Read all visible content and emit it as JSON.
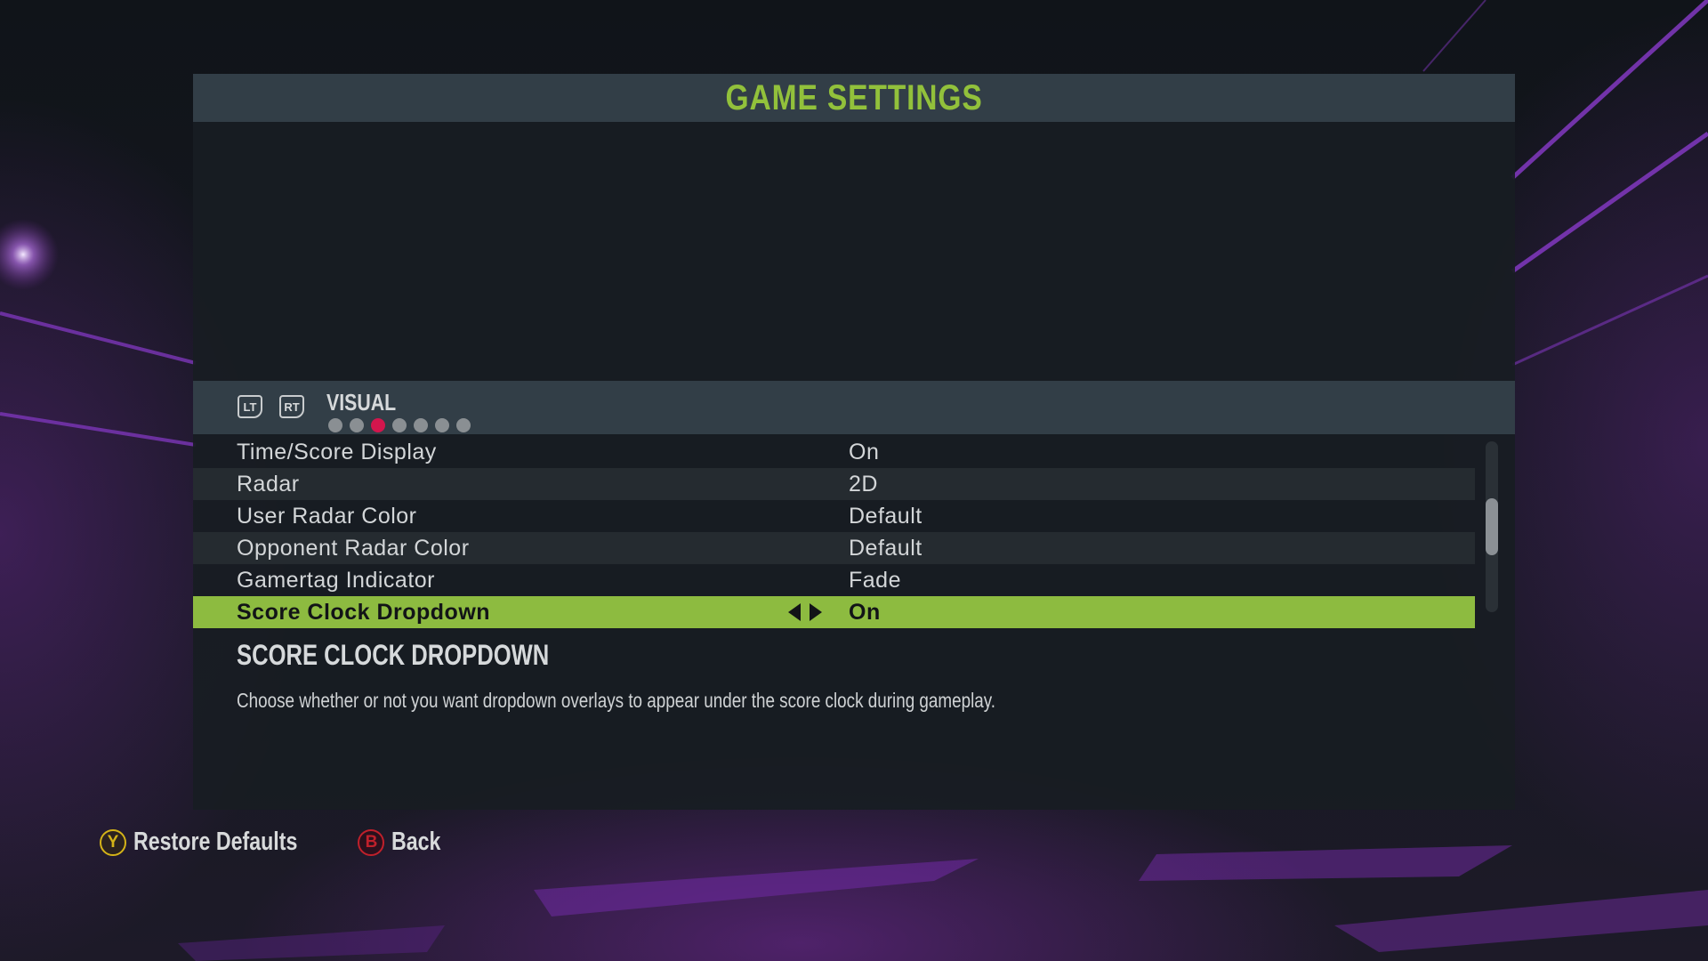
{
  "header": {
    "title": "GAME SETTINGS"
  },
  "tabs": {
    "left_trigger": "LT",
    "right_trigger": "RT",
    "current_label": "VISUAL",
    "page_count": 7,
    "current_page": 3
  },
  "settings": [
    {
      "label": "Time/Score Display",
      "value": "On"
    },
    {
      "label": "Radar",
      "value": "2D"
    },
    {
      "label": "User Radar Color",
      "value": "Default"
    },
    {
      "label": "Opponent Radar Color",
      "value": "Default"
    },
    {
      "label": "Gamertag Indicator",
      "value": "Fade"
    },
    {
      "label": "Score Clock Dropdown",
      "value": "On",
      "selected": true
    }
  ],
  "description": {
    "title": "SCORE CLOCK DROPDOWN",
    "text": "Choose whether or not you want dropdown overlays to appear under the score clock during gameplay."
  },
  "footer": {
    "restore": {
      "button": "Y",
      "label": "Restore Defaults"
    },
    "back": {
      "button": "B",
      "label": "Back"
    }
  },
  "colors": {
    "accent": "#8dbb40",
    "title": "#92c13b",
    "active_dot": "#d3164d",
    "button_y": "#d4b318",
    "button_b": "#c0202b"
  }
}
